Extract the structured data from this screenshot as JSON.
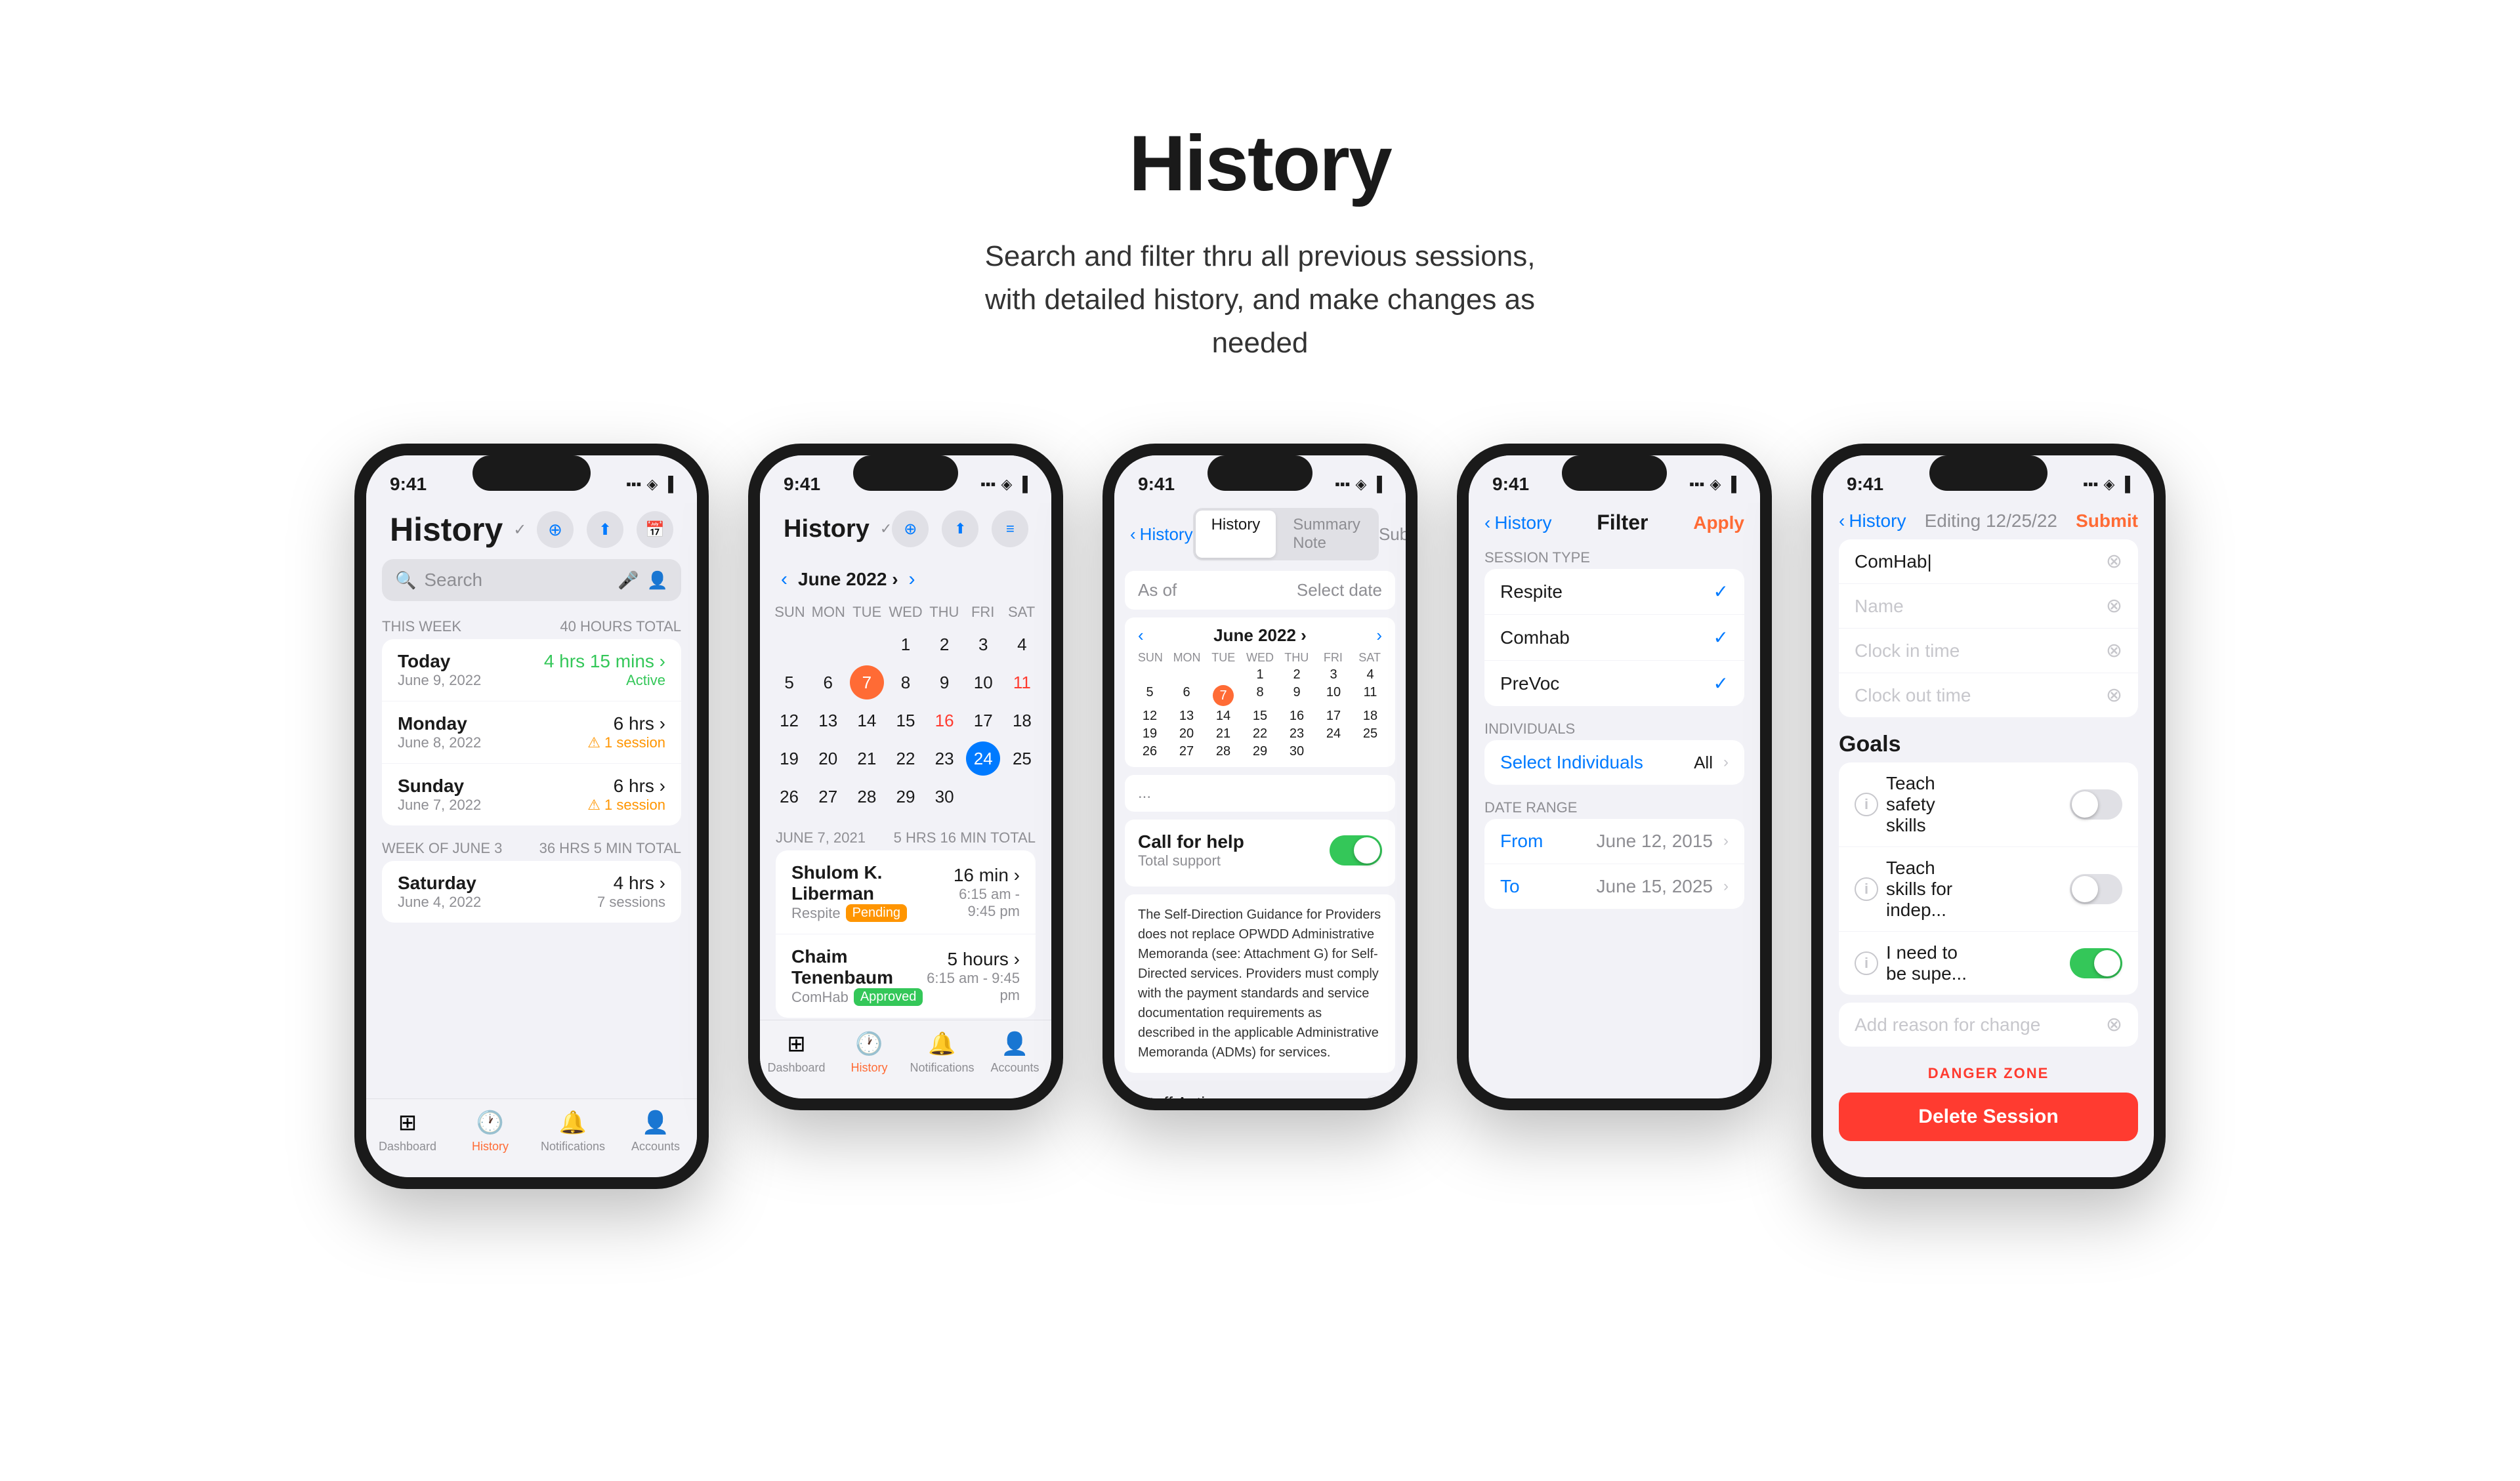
{
  "header": {
    "title": "History",
    "subtitle": "Search and filter thru all previous sessions, with detailed history, and make changes as needed"
  },
  "phone1": {
    "status_time": "9:41",
    "title": "History",
    "search_placeholder": "Search",
    "this_week_label": "THIS WEEK",
    "this_week_total": "40 HOURS TOTAL",
    "week_june3_label": "WEEK OF JUNE 3",
    "week_june3_total": "36 HRS 5 MIN TOTAL",
    "sessions_this_week": [
      {
        "name": "Today",
        "date": "June 9, 2022",
        "hours": "4 hrs 15 mins",
        "badge": "Active",
        "color": "green"
      },
      {
        "name": "Monday",
        "date": "June 8, 2022",
        "hours": "6 hrs",
        "badge": "1 session",
        "color": "orange"
      },
      {
        "name": "Sunday",
        "date": "June 7, 2022",
        "hours": "6 hrs",
        "badge": "1 session",
        "color": "orange"
      }
    ],
    "sessions_june3": [
      {
        "name": "Saturday",
        "date": "June 4, 2022",
        "hours": "4 hrs",
        "badge": "7 sessions"
      }
    ],
    "tabs": [
      "Dashboard",
      "History",
      "Notifications",
      "Accounts"
    ]
  },
  "phone2": {
    "status_time": "9:41",
    "title": "History",
    "month": "June 2022",
    "day_names": [
      "SUN",
      "MON",
      "TUE",
      "WED",
      "THU",
      "FRI",
      "SAT"
    ],
    "days_row1": [
      "",
      "",
      "",
      "1",
      "2",
      "3",
      "4",
      "5"
    ],
    "calendar_days": [
      [
        "",
        "",
        "",
        "1",
        "2",
        "3",
        "4",
        "5"
      ],
      [
        "6",
        "7",
        "8",
        "9",
        "10",
        "11",
        "12"
      ],
      [
        "13",
        "14",
        "15",
        "16",
        "17",
        "18",
        "19"
      ],
      [
        "20",
        "21",
        "22",
        "23",
        "24",
        "25",
        "26"
      ],
      [
        "27",
        "28",
        "29",
        "30",
        "",
        "",
        ""
      ]
    ],
    "highlighted_day": "7",
    "red_days": [
      "11",
      "16"
    ],
    "selected_day": "24",
    "week_label": "JUNE 7, 2021",
    "week_total": "5 HRS 16 MIN TOTAL",
    "sessions": [
      {
        "name": "Shulom K. Liberman",
        "type": "Respite",
        "status": "Pending",
        "hours": "16 min",
        "time": "6:15 am - 9:45 pm"
      },
      {
        "name": "Chaim Tenenbaum",
        "type": "ComHab",
        "status": "Approved",
        "hours": "5 hours",
        "time": "6:15 am - 9:45 pm"
      }
    ],
    "tabs": [
      "Dashboard",
      "History",
      "Notifications",
      "Accounts"
    ]
  },
  "phone3": {
    "status_time": "9:41",
    "back_label": "History",
    "tab_history": "History",
    "tab_summary": "Summary Note",
    "submit_label": "Submit",
    "as_of_label": "As of",
    "select_date": "Select date",
    "month": "June 2022",
    "day_names": [
      "SUN",
      "MON",
      "TUE",
      "WED",
      "THU",
      "FRI",
      "SAT"
    ],
    "calendar_days": [
      [
        "",
        "",
        "",
        "1",
        "2",
        "3",
        "4"
      ],
      [
        "5",
        "6",
        "7",
        "8",
        "9",
        "10",
        "11"
      ],
      [
        "12",
        "13",
        "14",
        "15",
        "16",
        "17",
        "18"
      ],
      [
        "19",
        "20",
        "21",
        "22",
        "23",
        "24",
        "25"
      ],
      [
        "26",
        "27",
        "28",
        "29",
        "30",
        "",
        ""
      ]
    ],
    "today_day": "7",
    "call_for_help_title": "Call for help",
    "call_for_help_sub": "Total support",
    "help_text": "The Self-Direction Guidance for Providers does not replace OPWDD Administrative Memoranda (see: Attachment G) for Self-Directed services. Providers must comply with the payment standards and service documentation requirements as described in the applicable Administrative Memoranda (ADMs) for services.",
    "staff_action_label": "Staff Action"
  },
  "phone4": {
    "status_time": "9:41",
    "back_label": "History",
    "filter_label": "Filter",
    "apply_label": "Apply",
    "session_type_title": "SESSION TYPE",
    "session_types": [
      {
        "name": "Respite",
        "checked": true
      },
      {
        "name": "Comhab",
        "checked": true
      },
      {
        "name": "PreVoc",
        "checked": true
      }
    ],
    "individuals_title": "INDIVIDUALS",
    "select_individuals": "Select Individuals",
    "all_label": "All",
    "date_range_title": "DATE RANGE",
    "from_label": "From",
    "from_date": "June 12, 2015",
    "to_label": "To",
    "to_date": "June 15, 2025"
  },
  "phone5": {
    "status_time": "9:41",
    "back_label": "History",
    "editing_label": "Editing 12/25/22",
    "submit_label": "Submit",
    "fields": {
      "comhab_value": "ComHab|",
      "name_placeholder": "Name",
      "clock_in_placeholder": "Clock in time",
      "clock_out_placeholder": "Clock out time"
    },
    "goals_title": "Goals",
    "goals": [
      {
        "label": "Teach safety skills",
        "on": false
      },
      {
        "label": "Teach skills for indep...",
        "on": false
      },
      {
        "label": "I need to be supe...",
        "on": true
      }
    ],
    "add_reason_placeholder": "Add reason for change",
    "danger_zone_label": "DANGER ZONE",
    "delete_label": "Delete Session"
  },
  "colors": {
    "accent_orange": "#ff6b35",
    "accent_blue": "#007aff",
    "accent_green": "#34c759",
    "accent_red": "#ff3b30",
    "text_primary": "#1a1a1a",
    "text_secondary": "#8e8e93",
    "bg_primary": "#f2f2f7",
    "bg_card": "#ffffff"
  }
}
